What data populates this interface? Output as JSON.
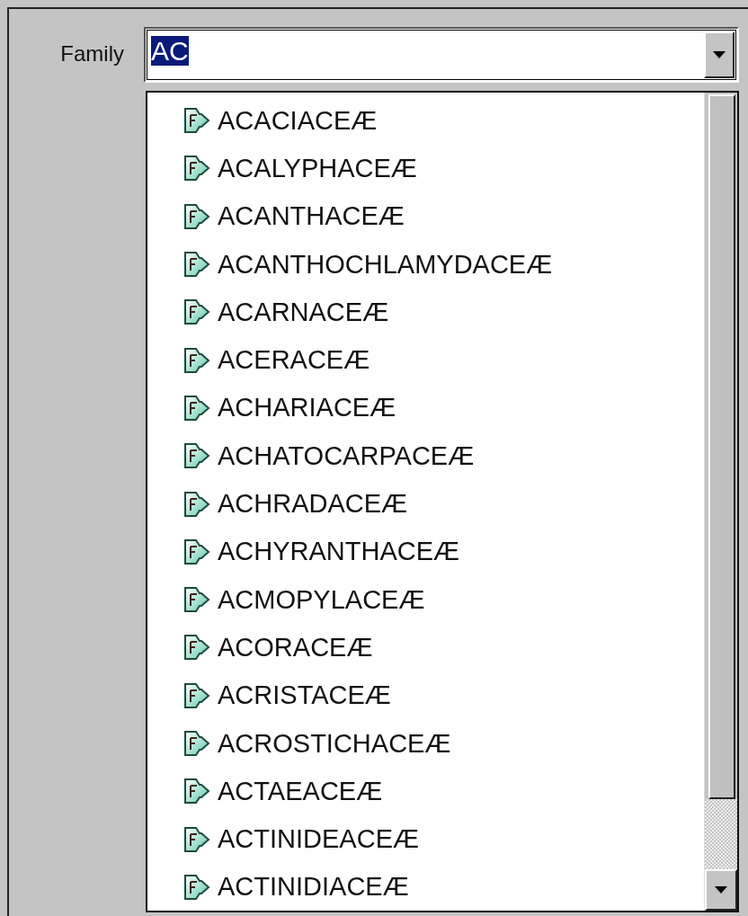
{
  "field": {
    "label": "Family",
    "value": "AC"
  },
  "dropdown": {
    "items": [
      {
        "label": "ACACIACEÆ"
      },
      {
        "label": "ACALYPHACEÆ"
      },
      {
        "label": "ACANTHACEÆ"
      },
      {
        "label": "ACANTHOCHLAMYDACEÆ"
      },
      {
        "label": "ACARNACEÆ"
      },
      {
        "label": "ACERACEÆ"
      },
      {
        "label": "ACHARIACEÆ"
      },
      {
        "label": "ACHATOCARPACEÆ"
      },
      {
        "label": "ACHRADACEÆ"
      },
      {
        "label": "ACHYRANTHACEÆ"
      },
      {
        "label": "ACMOPYLACEÆ"
      },
      {
        "label": "ACORACEÆ"
      },
      {
        "label": "ACRISTACEÆ"
      },
      {
        "label": "ACROSTICHACEÆ"
      },
      {
        "label": "ACTAEACEÆ"
      },
      {
        "label": "ACTINIDEACEÆ"
      },
      {
        "label": "ACTINIDIACEÆ"
      }
    ]
  }
}
